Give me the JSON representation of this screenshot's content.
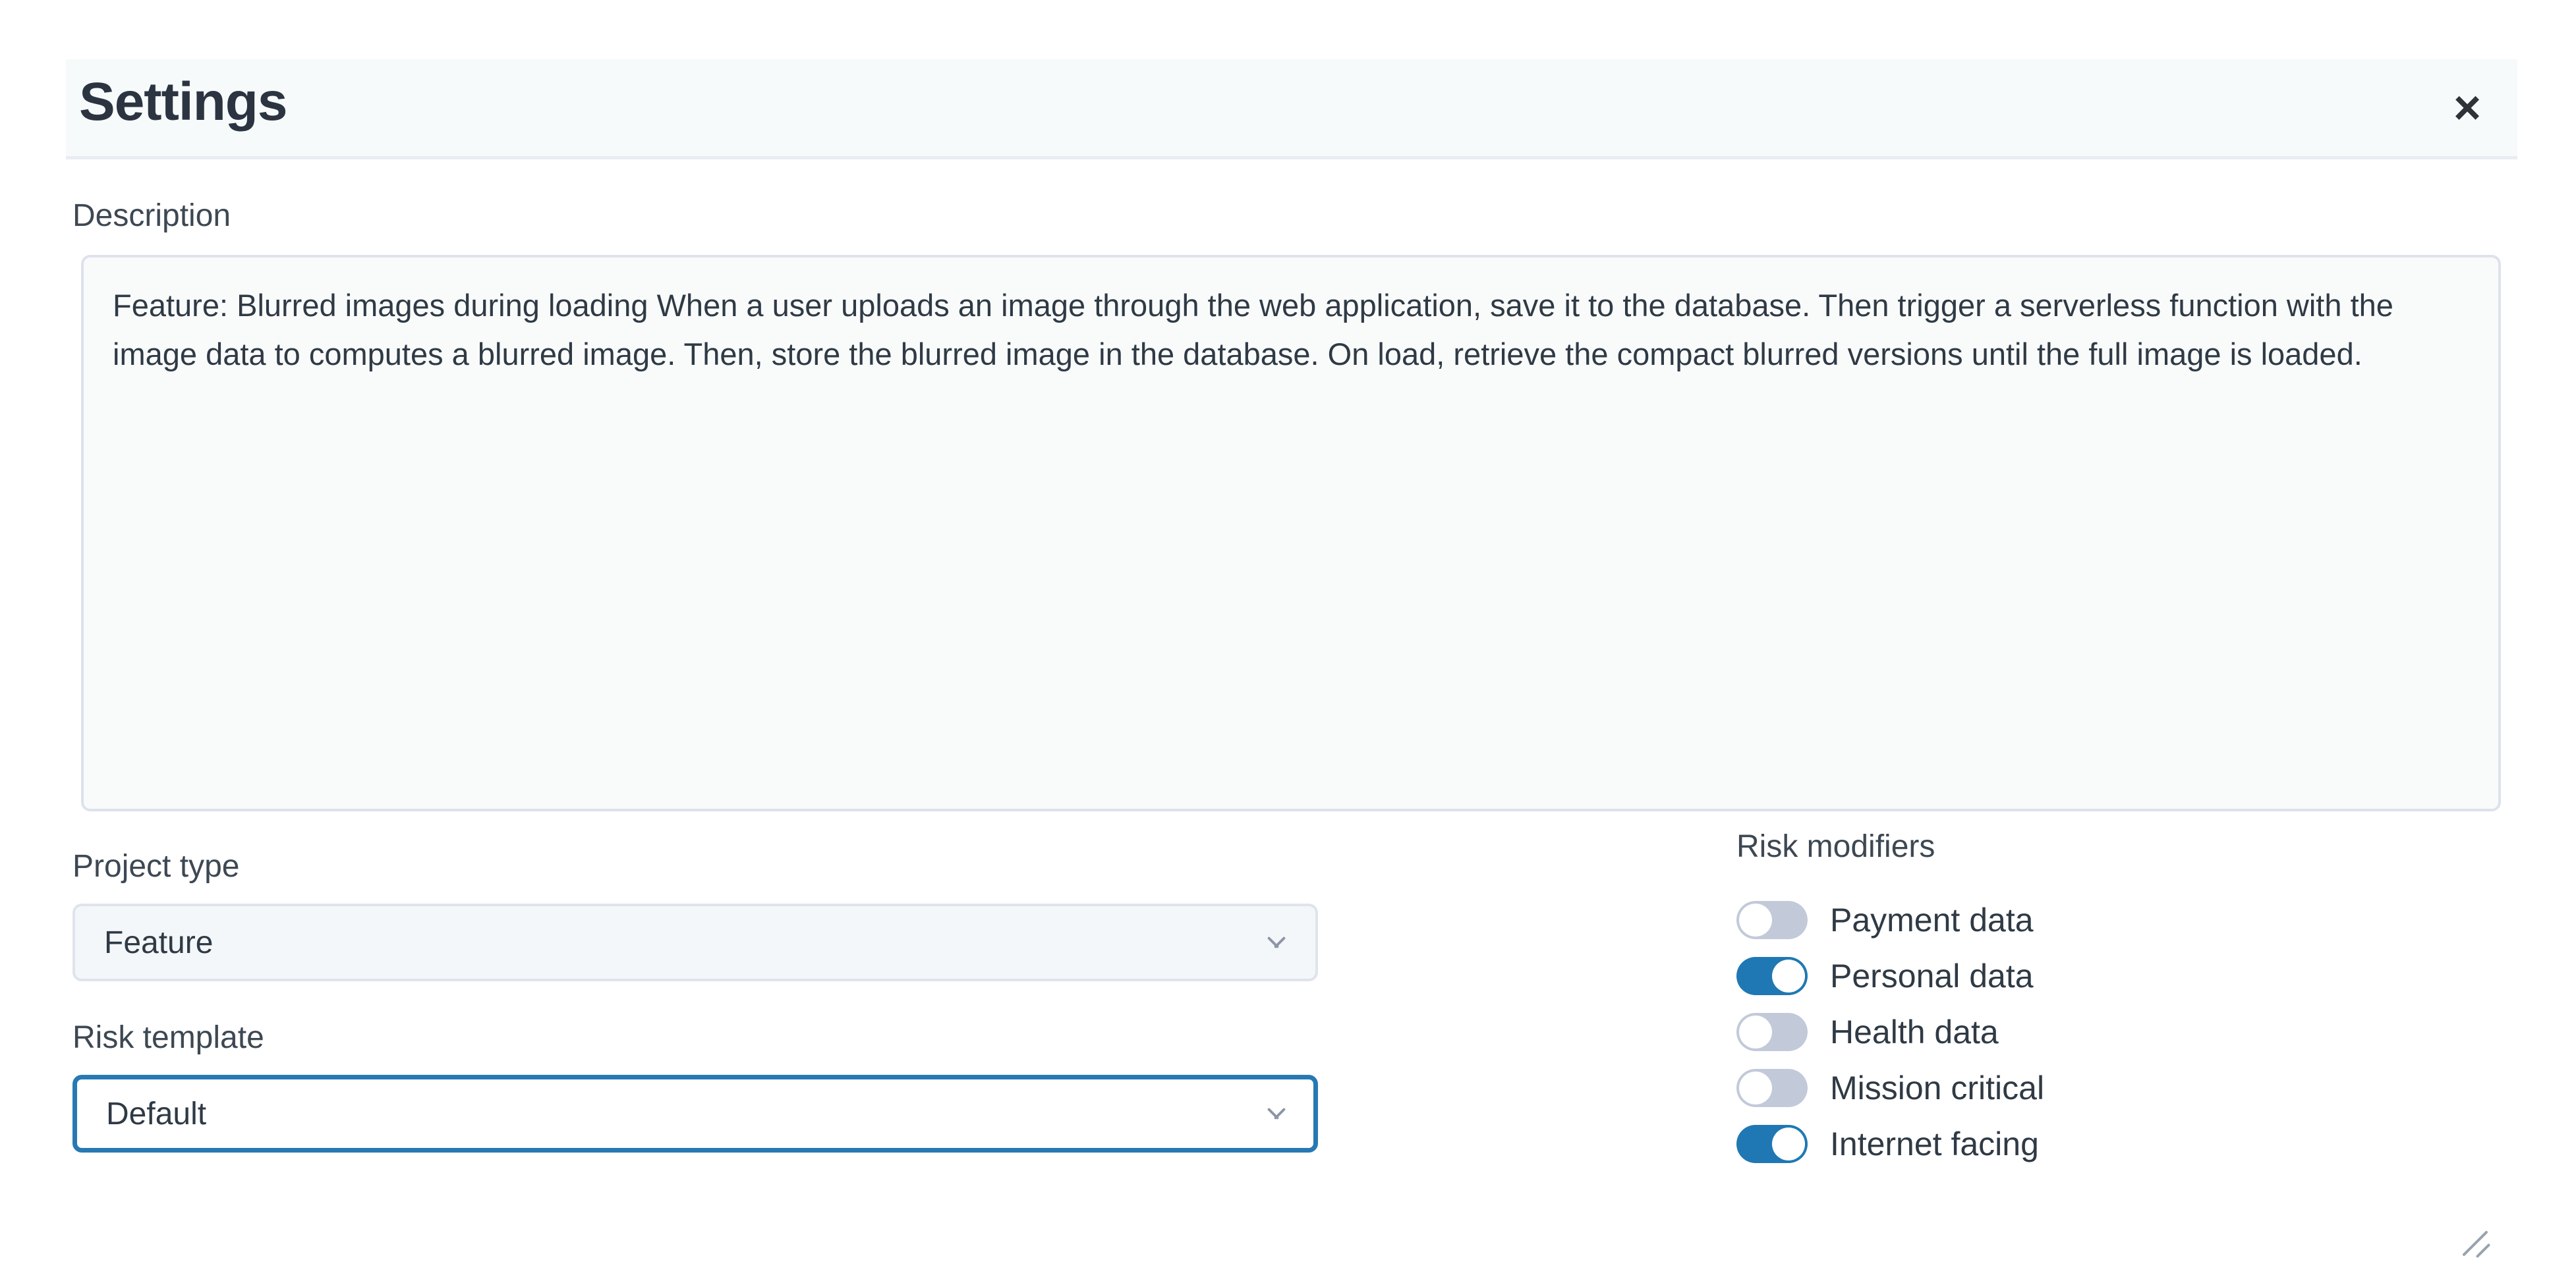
{
  "modal": {
    "title": "Settings",
    "close_icon": "close-icon",
    "close_label": "×"
  },
  "description": {
    "label": "Description",
    "value": "Feature: Blurred images during loading When a user uploads an image through the web application, save it to the database. Then trigger a serverless function with the image data to computes a blurred image. Then, store the blurred image in the database. On load, retrieve the compact blurred versions until the full image is loaded.",
    "placeholder": "",
    "resize_icon": "resize-grip-icon"
  },
  "project_type": {
    "label": "Project type",
    "value": "Feature",
    "chevron_icon": "chevron-down-icon",
    "focused": false
  },
  "risk_template": {
    "label": "Risk template",
    "value": "Default",
    "chevron_icon": "chevron-down-icon",
    "focused": true
  },
  "risk_modifiers": {
    "title": "Risk modifiers",
    "items": [
      {
        "label": "Payment data",
        "on": false
      },
      {
        "label": "Personal data",
        "on": true
      },
      {
        "label": "Health data",
        "on": false
      },
      {
        "label": "Mission critical",
        "on": false
      },
      {
        "label": "Internet facing",
        "on": true
      }
    ]
  },
  "colors": {
    "accent": "#1f78b4",
    "focus_border": "#2779b3",
    "toggle_off": "#c2cada",
    "header_bg": "#f7fafa",
    "header_border": "#e9ecf2",
    "input_bg": "#f9fbfb",
    "input_border": "#dde2ec",
    "text": "#2f3a45",
    "title_text": "#2b3440"
  }
}
